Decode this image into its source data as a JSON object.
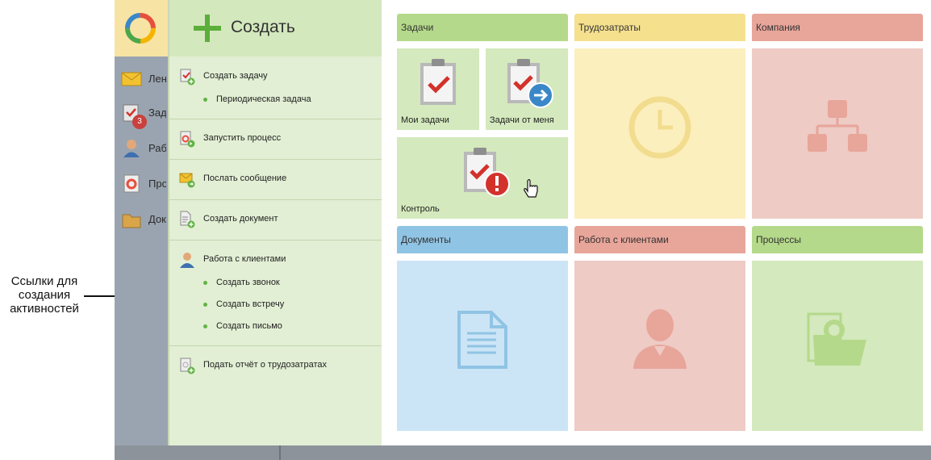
{
  "annotation": {
    "text_line1": "Ссылки для",
    "text_line2": "создания",
    "text_line3": "активностей"
  },
  "app_sidebar": {
    "items": [
      {
        "label": "Лента",
        "icon": "mail-icon"
      },
      {
        "label": "Задачи",
        "icon": "tasks-icon",
        "badge": "3"
      },
      {
        "label": "Работа",
        "icon": "person-icon"
      },
      {
        "label": "Процессы",
        "icon": "process-icon"
      },
      {
        "label": "Документы",
        "icon": "folder-icon"
      }
    ]
  },
  "create_panel": {
    "title": "Создать",
    "items": [
      {
        "label": "Создать задачу",
        "icon": "task-add-icon"
      },
      {
        "label": "Периодическая задача"
      },
      {
        "label": "Запустить процесс",
        "icon": "process-start-icon"
      },
      {
        "label": "Послать сообщение",
        "icon": "message-add-icon"
      },
      {
        "label": "Создать документ",
        "icon": "document-add-icon"
      },
      {
        "label": "Работа с клиентами",
        "icon": "client-icon"
      },
      {
        "label": "Создать звонок"
      },
      {
        "label": "Создать встречу"
      },
      {
        "label": "Создать письмо"
      },
      {
        "label": "Подать отчёт о трудозатратах",
        "icon": "report-add-icon"
      }
    ]
  },
  "tiles": {
    "tasks": {
      "header": "Задачи",
      "my_tasks": "Мои задачи",
      "from_me": "Задачи от меня",
      "control": "Контроль"
    },
    "labor": {
      "header": "Трудозатраты"
    },
    "company": {
      "header": "Компания"
    },
    "documents": {
      "header": "Документы"
    },
    "clients": {
      "header": "Работа с клиентами"
    },
    "processes": {
      "header": "Процессы"
    }
  },
  "colors": {
    "green": "#b5d98a",
    "green_light": "#d4e9bd",
    "yellow": "#f5e08e",
    "yellow_light": "#fcefbe",
    "red": "#e8a59a",
    "red_light": "#eecbc5",
    "blue": "#90c4e4",
    "blue_light": "#cce5f6"
  }
}
